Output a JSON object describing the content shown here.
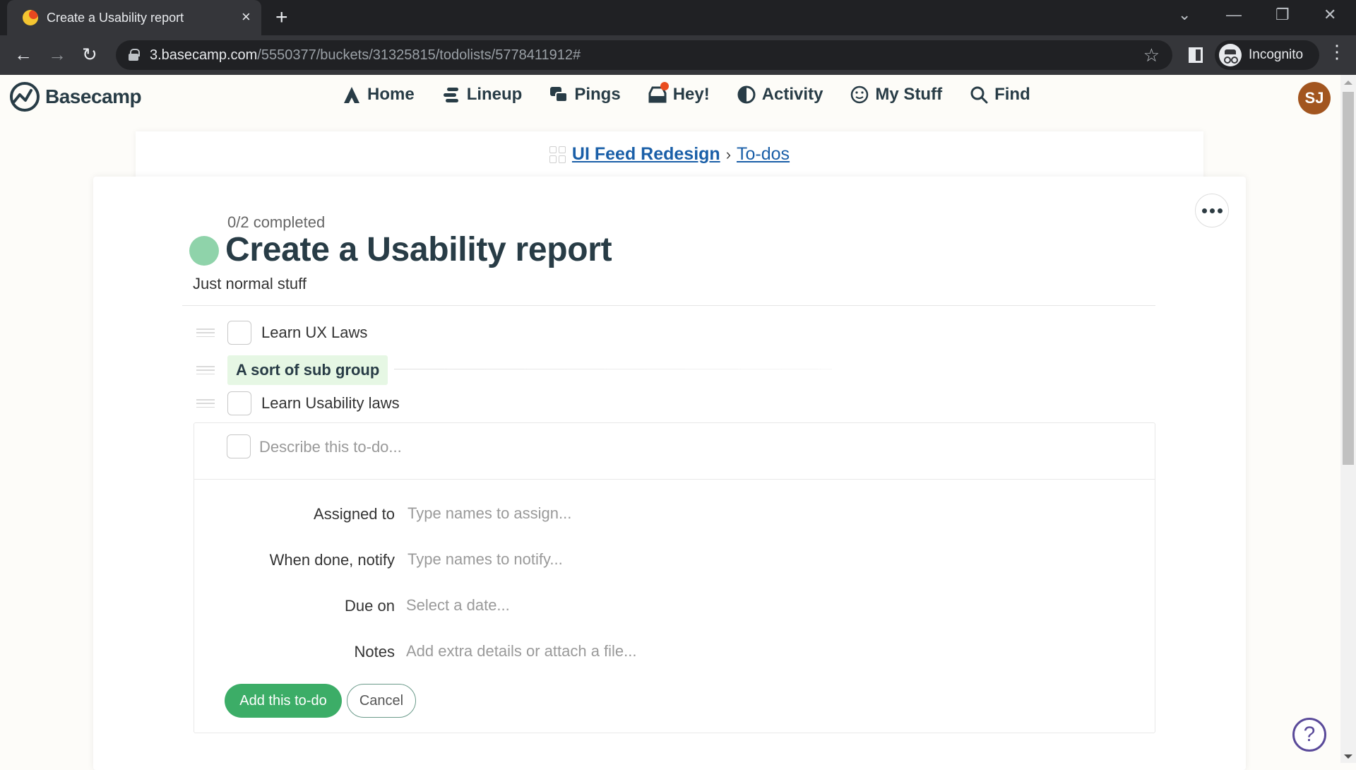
{
  "browser": {
    "tab_title": "Create a Usability report",
    "tab_close": "×",
    "new_tab": "+",
    "url_host": "3.basecamp.com",
    "url_path": "/5550377/buckets/31325815/todolists/5778411912#",
    "profile_label": "Incognito",
    "window_controls": {
      "dropdown": "⌄",
      "minimize": "—",
      "restore": "❐",
      "close": "✕"
    },
    "nav": {
      "back": "←",
      "forward": "→",
      "reload": "↻"
    },
    "star": "☆",
    "menu": "⋮"
  },
  "app": {
    "brand": "Basecamp",
    "nav": [
      {
        "label": "Home",
        "icon": "home-icon"
      },
      {
        "label": "Lineup",
        "icon": "lineup-icon"
      },
      {
        "label": "Pings",
        "icon": "pings-icon"
      },
      {
        "label": "Hey!",
        "icon": "hey-icon"
      },
      {
        "label": "Activity",
        "icon": "activity-icon"
      },
      {
        "label": "My Stuff",
        "icon": "my-stuff-icon"
      },
      {
        "label": "Find",
        "icon": "find-icon"
      }
    ],
    "avatar_initials": "SJ",
    "avatar_color": "#a2551f",
    "hey_badge_color": "#ea4c1e"
  },
  "breadcrumb": {
    "project": "UI Feed Redesign",
    "separator": "›",
    "section": "To-dos"
  },
  "todolist": {
    "progress": "0/2 completed",
    "title": "Create a Usability report",
    "description": "Just normal stuff",
    "status_color": "#8fd3aa",
    "items": [
      {
        "type": "todo",
        "label": "Learn UX Laws",
        "checked": false
      },
      {
        "type": "group",
        "label": "A sort of sub group"
      },
      {
        "type": "todo",
        "label": "Learn Usability laws",
        "checked": false
      }
    ]
  },
  "new_todo": {
    "placeholder": "Describe this to-do...",
    "fields": [
      {
        "label": "Assigned to",
        "placeholder": "Type names to assign..."
      },
      {
        "label": "When done, notify",
        "placeholder": "Type names to notify..."
      },
      {
        "label": "Due on",
        "placeholder": "Select a date..."
      },
      {
        "label": "Notes",
        "placeholder": "Add extra details or attach a file..."
      }
    ],
    "submit_label": "Add this to-do",
    "cancel_label": "Cancel",
    "submit_color": "#3cad67"
  },
  "help": {
    "label": "?"
  }
}
